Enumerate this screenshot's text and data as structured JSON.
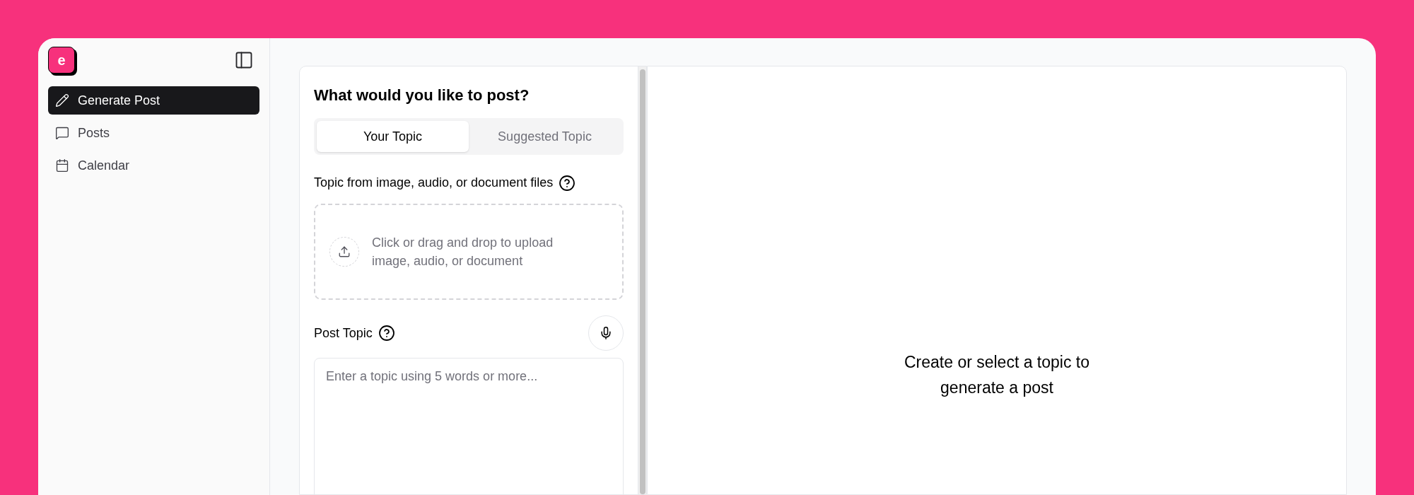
{
  "logo": {
    "letter": "e"
  },
  "sidebar": {
    "items": [
      {
        "kind": "pencil",
        "label": "Generate Post",
        "selected": true
      },
      {
        "kind": "message",
        "label": "Posts",
        "selected": false
      },
      {
        "kind": "calendar",
        "label": "Calendar",
        "selected": false
      }
    ]
  },
  "form": {
    "title": "What would you like to post?",
    "tabs": [
      {
        "label": "Your Topic",
        "selected": true
      },
      {
        "label": "Suggested Topic",
        "selected": false
      }
    ],
    "upload": {
      "label": "Topic from image, audio, or document files",
      "hint": "Click or drag and drop to upload image, audio, or document"
    },
    "topic": {
      "label": "Post Topic",
      "placeholder": "Enter a topic using 5 words or more..."
    }
  },
  "preview": {
    "message": "Create or select a topic to generate a post"
  }
}
